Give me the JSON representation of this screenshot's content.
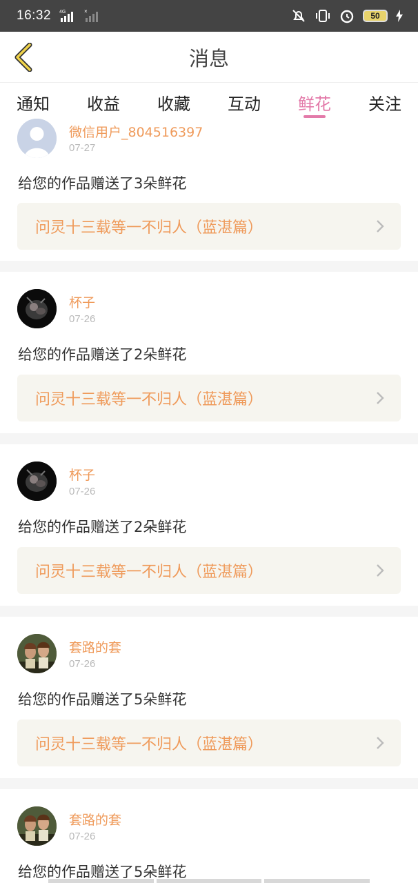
{
  "status_bar": {
    "time": "16:32",
    "network_label": "4G",
    "battery": "50"
  },
  "header": {
    "title": "消息",
    "back_icon": "chevron-left-icon"
  },
  "tabs": [
    {
      "label": "通知",
      "active": false
    },
    {
      "label": "收益",
      "active": false
    },
    {
      "label": "收藏",
      "active": false
    },
    {
      "label": "互动",
      "active": false
    },
    {
      "label": "鲜花",
      "active": true
    },
    {
      "label": "关注",
      "active": false
    }
  ],
  "messages": [
    {
      "user": "微信用户_804516397",
      "date": "07-27",
      "text": "给您的作品赠送了3朵鲜花",
      "work": "问灵十三载等一不归人（蓝湛篇）",
      "avatar": "default-avatar"
    },
    {
      "user": "杯子",
      "date": "07-26",
      "text": "给您的作品赠送了2朵鲜花",
      "work": "问灵十三载等一不归人（蓝湛篇）",
      "avatar": "dark-photo-avatar"
    },
    {
      "user": "杯子",
      "date": "07-26",
      "text": "给您的作品赠送了2朵鲜花",
      "work": "问灵十三载等一不归人（蓝湛篇）",
      "avatar": "dark-photo-avatar"
    },
    {
      "user": "套路的套",
      "date": "07-26",
      "text": "给您的作品赠送了5朵鲜花",
      "work": "问灵十三载等一不归人（蓝湛篇）",
      "avatar": "couple-photo-avatar"
    },
    {
      "user": "套路的套",
      "date": "07-26",
      "text": "给您的作品赠送了5朵鲜花",
      "work": "",
      "avatar": "couple-photo-avatar"
    }
  ],
  "colors": {
    "accent": "#e37aa9",
    "username": "#ef9a5a",
    "link_bg": "#f6f5ef",
    "status_bar": "#444444"
  }
}
